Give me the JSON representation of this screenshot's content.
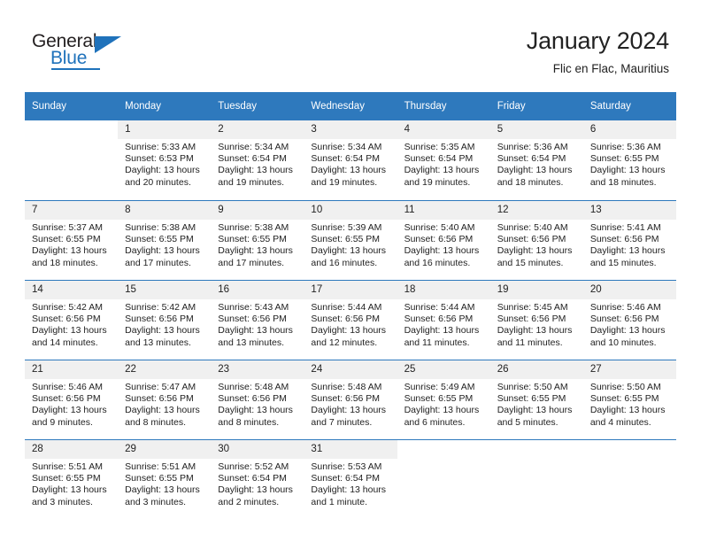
{
  "brand": {
    "name_top": "General",
    "name_bottom": "Blue",
    "accent_color": "#1f72bb"
  },
  "header": {
    "title": "January 2024",
    "subtitle": "Flic en Flac, Mauritius"
  },
  "calendar": {
    "header_color": "#2e79bd",
    "daynum_bg": "#f0f0f0",
    "weekday_names": [
      "Sunday",
      "Monday",
      "Tuesday",
      "Wednesday",
      "Thursday",
      "Friday",
      "Saturday"
    ],
    "weeks": [
      [
        {
          "day": "",
          "sunrise": "",
          "sunset": "",
          "daylight": ""
        },
        {
          "day": "1",
          "sunrise": "Sunrise: 5:33 AM",
          "sunset": "Sunset: 6:53 PM",
          "daylight": "Daylight: 13 hours and 20 minutes."
        },
        {
          "day": "2",
          "sunrise": "Sunrise: 5:34 AM",
          "sunset": "Sunset: 6:54 PM",
          "daylight": "Daylight: 13 hours and 19 minutes."
        },
        {
          "day": "3",
          "sunrise": "Sunrise: 5:34 AM",
          "sunset": "Sunset: 6:54 PM",
          "daylight": "Daylight: 13 hours and 19 minutes."
        },
        {
          "day": "4",
          "sunrise": "Sunrise: 5:35 AM",
          "sunset": "Sunset: 6:54 PM",
          "daylight": "Daylight: 13 hours and 19 minutes."
        },
        {
          "day": "5",
          "sunrise": "Sunrise: 5:36 AM",
          "sunset": "Sunset: 6:54 PM",
          "daylight": "Daylight: 13 hours and 18 minutes."
        },
        {
          "day": "6",
          "sunrise": "Sunrise: 5:36 AM",
          "sunset": "Sunset: 6:55 PM",
          "daylight": "Daylight: 13 hours and 18 minutes."
        }
      ],
      [
        {
          "day": "7",
          "sunrise": "Sunrise: 5:37 AM",
          "sunset": "Sunset: 6:55 PM",
          "daylight": "Daylight: 13 hours and 18 minutes."
        },
        {
          "day": "8",
          "sunrise": "Sunrise: 5:38 AM",
          "sunset": "Sunset: 6:55 PM",
          "daylight": "Daylight: 13 hours and 17 minutes."
        },
        {
          "day": "9",
          "sunrise": "Sunrise: 5:38 AM",
          "sunset": "Sunset: 6:55 PM",
          "daylight": "Daylight: 13 hours and 17 minutes."
        },
        {
          "day": "10",
          "sunrise": "Sunrise: 5:39 AM",
          "sunset": "Sunset: 6:55 PM",
          "daylight": "Daylight: 13 hours and 16 minutes."
        },
        {
          "day": "11",
          "sunrise": "Sunrise: 5:40 AM",
          "sunset": "Sunset: 6:56 PM",
          "daylight": "Daylight: 13 hours and 16 minutes."
        },
        {
          "day": "12",
          "sunrise": "Sunrise: 5:40 AM",
          "sunset": "Sunset: 6:56 PM",
          "daylight": "Daylight: 13 hours and 15 minutes."
        },
        {
          "day": "13",
          "sunrise": "Sunrise: 5:41 AM",
          "sunset": "Sunset: 6:56 PM",
          "daylight": "Daylight: 13 hours and 15 minutes."
        }
      ],
      [
        {
          "day": "14",
          "sunrise": "Sunrise: 5:42 AM",
          "sunset": "Sunset: 6:56 PM",
          "daylight": "Daylight: 13 hours and 14 minutes."
        },
        {
          "day": "15",
          "sunrise": "Sunrise: 5:42 AM",
          "sunset": "Sunset: 6:56 PM",
          "daylight": "Daylight: 13 hours and 13 minutes."
        },
        {
          "day": "16",
          "sunrise": "Sunrise: 5:43 AM",
          "sunset": "Sunset: 6:56 PM",
          "daylight": "Daylight: 13 hours and 13 minutes."
        },
        {
          "day": "17",
          "sunrise": "Sunrise: 5:44 AM",
          "sunset": "Sunset: 6:56 PM",
          "daylight": "Daylight: 13 hours and 12 minutes."
        },
        {
          "day": "18",
          "sunrise": "Sunrise: 5:44 AM",
          "sunset": "Sunset: 6:56 PM",
          "daylight": "Daylight: 13 hours and 11 minutes."
        },
        {
          "day": "19",
          "sunrise": "Sunrise: 5:45 AM",
          "sunset": "Sunset: 6:56 PM",
          "daylight": "Daylight: 13 hours and 11 minutes."
        },
        {
          "day": "20",
          "sunrise": "Sunrise: 5:46 AM",
          "sunset": "Sunset: 6:56 PM",
          "daylight": "Daylight: 13 hours and 10 minutes."
        }
      ],
      [
        {
          "day": "21",
          "sunrise": "Sunrise: 5:46 AM",
          "sunset": "Sunset: 6:56 PM",
          "daylight": "Daylight: 13 hours and 9 minutes."
        },
        {
          "day": "22",
          "sunrise": "Sunrise: 5:47 AM",
          "sunset": "Sunset: 6:56 PM",
          "daylight": "Daylight: 13 hours and 8 minutes."
        },
        {
          "day": "23",
          "sunrise": "Sunrise: 5:48 AM",
          "sunset": "Sunset: 6:56 PM",
          "daylight": "Daylight: 13 hours and 8 minutes."
        },
        {
          "day": "24",
          "sunrise": "Sunrise: 5:48 AM",
          "sunset": "Sunset: 6:56 PM",
          "daylight": "Daylight: 13 hours and 7 minutes."
        },
        {
          "day": "25",
          "sunrise": "Sunrise: 5:49 AM",
          "sunset": "Sunset: 6:55 PM",
          "daylight": "Daylight: 13 hours and 6 minutes."
        },
        {
          "day": "26",
          "sunrise": "Sunrise: 5:50 AM",
          "sunset": "Sunset: 6:55 PM",
          "daylight": "Daylight: 13 hours and 5 minutes."
        },
        {
          "day": "27",
          "sunrise": "Sunrise: 5:50 AM",
          "sunset": "Sunset: 6:55 PM",
          "daylight": "Daylight: 13 hours and 4 minutes."
        }
      ],
      [
        {
          "day": "28",
          "sunrise": "Sunrise: 5:51 AM",
          "sunset": "Sunset: 6:55 PM",
          "daylight": "Daylight: 13 hours and 3 minutes."
        },
        {
          "day": "29",
          "sunrise": "Sunrise: 5:51 AM",
          "sunset": "Sunset: 6:55 PM",
          "daylight": "Daylight: 13 hours and 3 minutes."
        },
        {
          "day": "30",
          "sunrise": "Sunrise: 5:52 AM",
          "sunset": "Sunset: 6:54 PM",
          "daylight": "Daylight: 13 hours and 2 minutes."
        },
        {
          "day": "31",
          "sunrise": "Sunrise: 5:53 AM",
          "sunset": "Sunset: 6:54 PM",
          "daylight": "Daylight: 13 hours and 1 minute."
        },
        {
          "day": "",
          "sunrise": "",
          "sunset": "",
          "daylight": ""
        },
        {
          "day": "",
          "sunrise": "",
          "sunset": "",
          "daylight": ""
        },
        {
          "day": "",
          "sunrise": "",
          "sunset": "",
          "daylight": ""
        }
      ]
    ]
  }
}
